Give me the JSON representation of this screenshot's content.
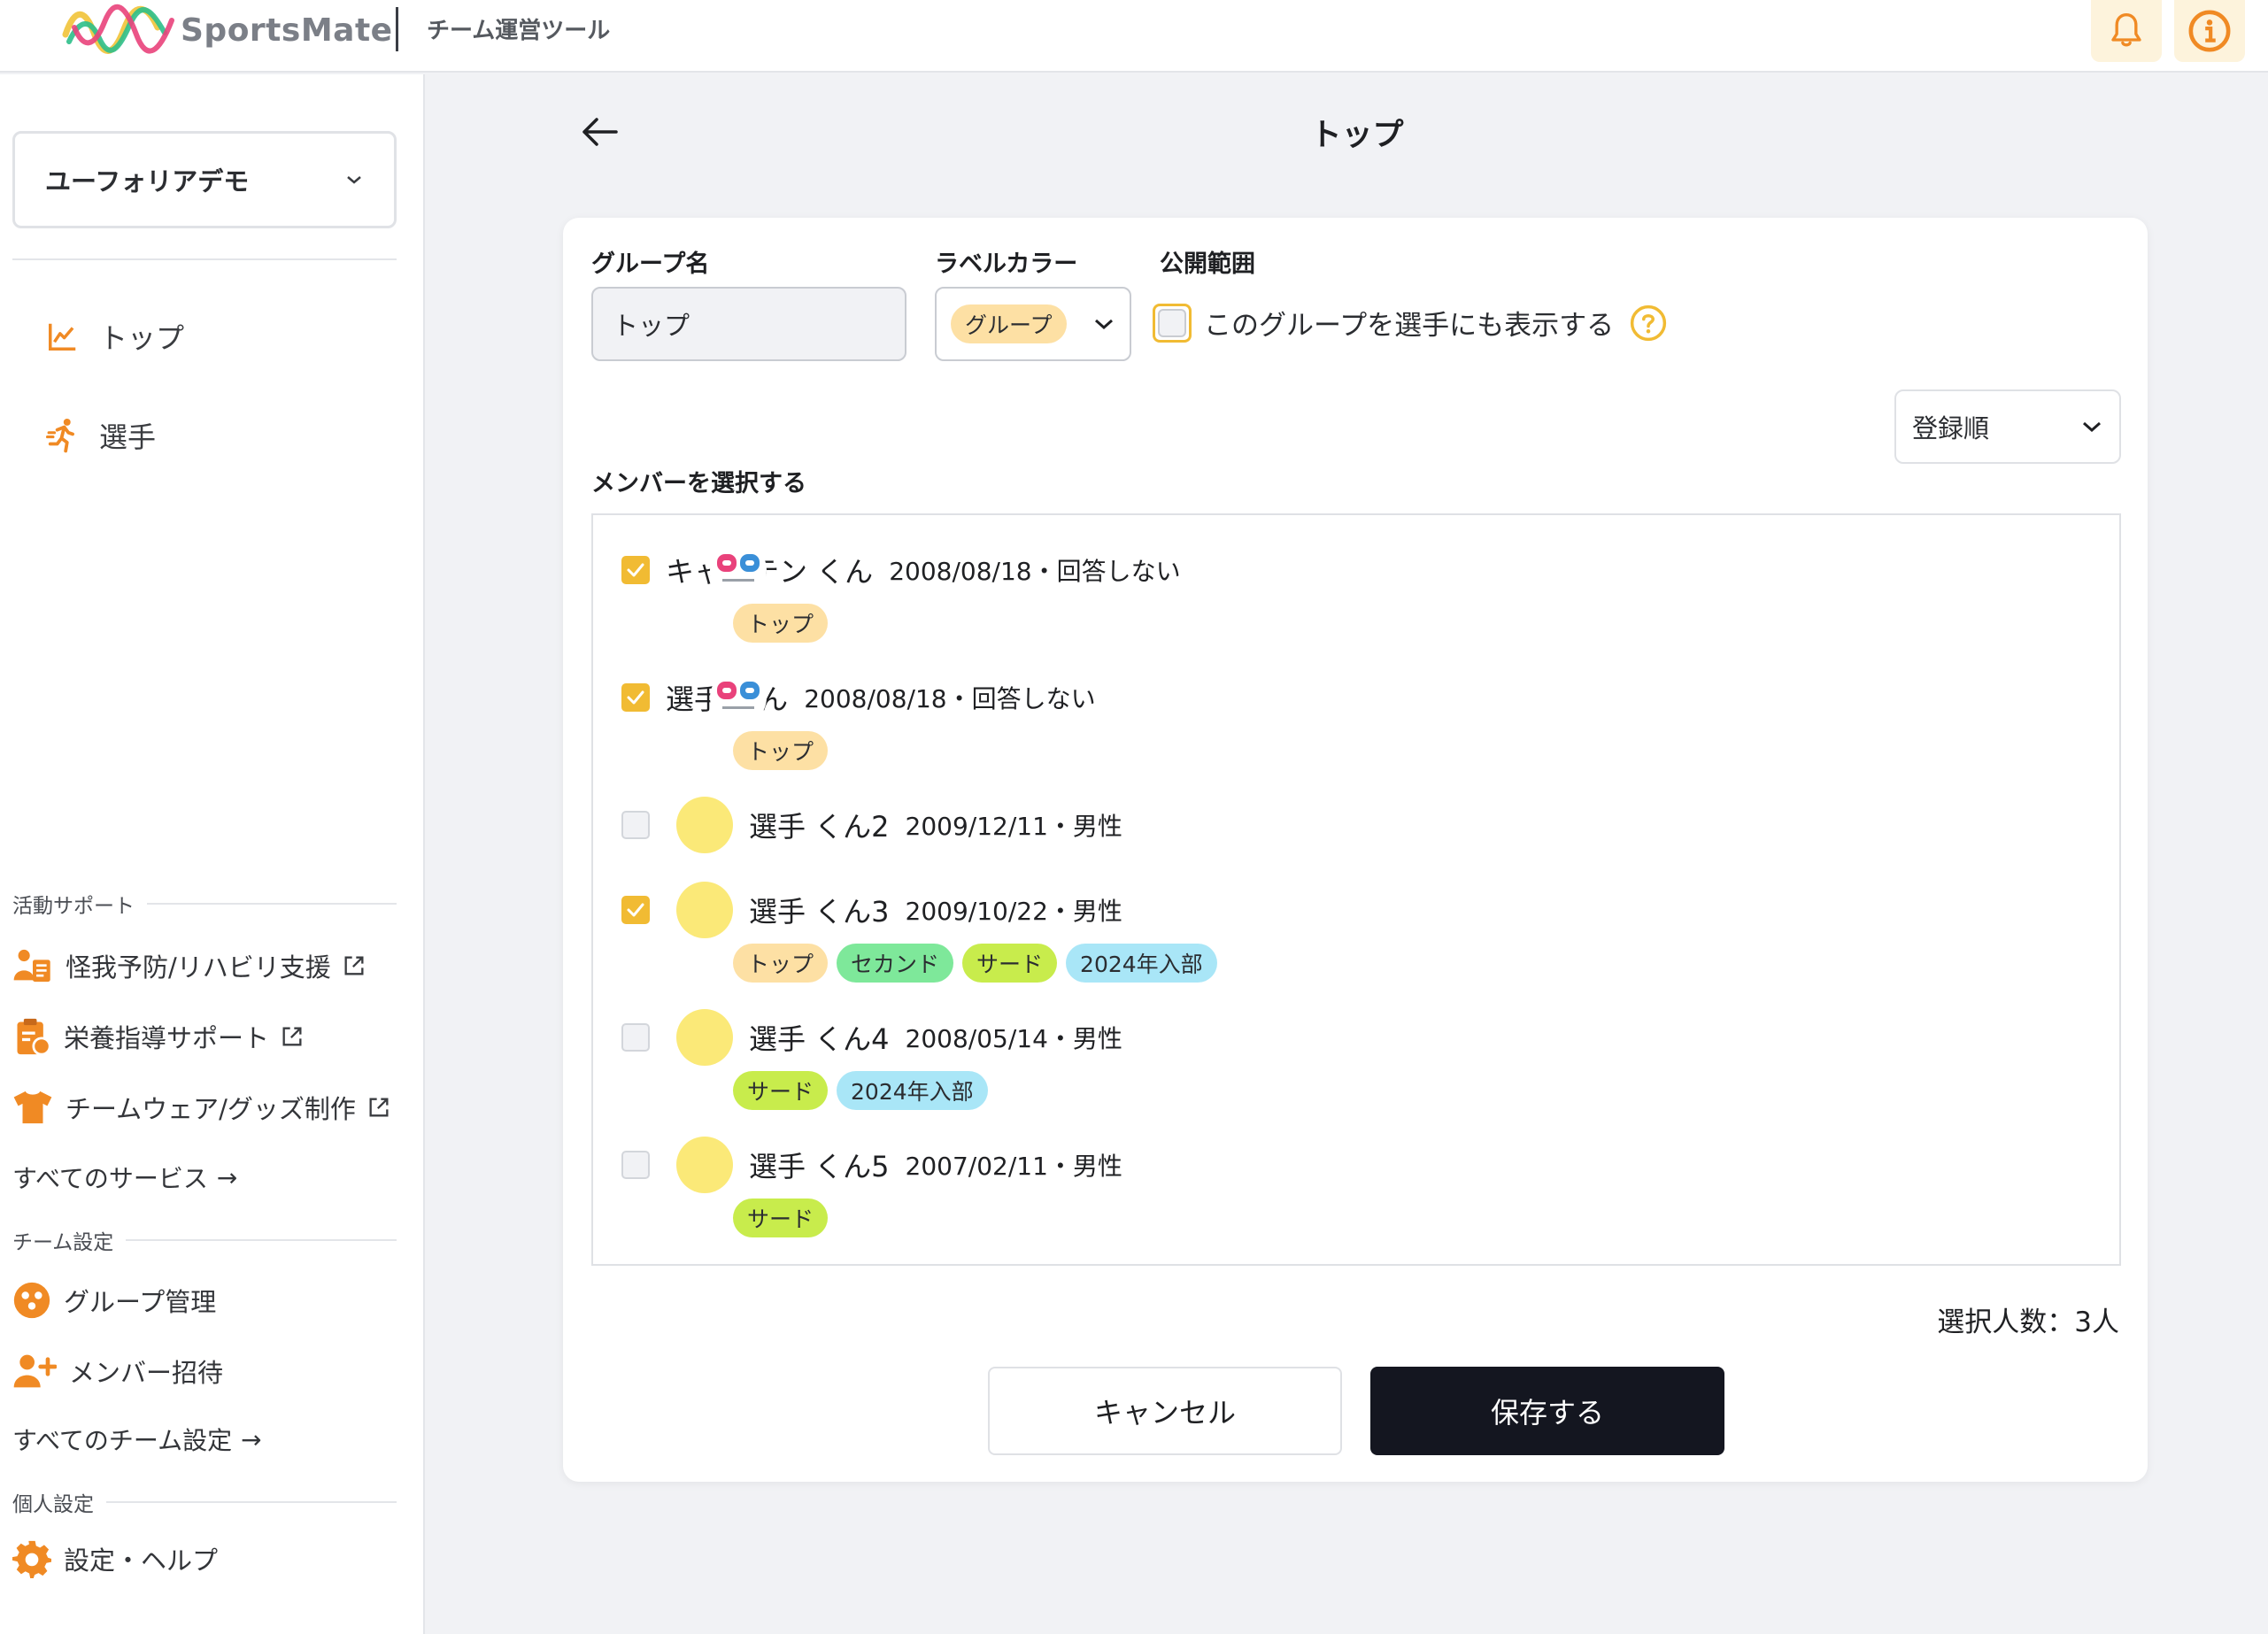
{
  "header": {
    "brand": "SportsMate",
    "subtitle": "チーム運営ツール",
    "bell_icon": "bell-icon",
    "info_icon": "info-icon"
  },
  "sidebar": {
    "team_name": "ユーフォリアデモ",
    "nav": [
      {
        "label": "トップ",
        "icon": "chart-line-icon"
      },
      {
        "label": "選手",
        "icon": "running-person-icon"
      }
    ],
    "sections": {
      "support_title": "活動サポート",
      "support_items": [
        {
          "label": "怪我予防/リハビリ支援",
          "icon": "person-clipboard-icon"
        },
        {
          "label": "栄養指導サポート",
          "icon": "clipboard-icon"
        },
        {
          "label": "チームウェア/グッズ制作",
          "icon": "tshirt-icon"
        }
      ],
      "all_services": "すべてのサービス",
      "team_title": "チーム設定",
      "team_items": [
        {
          "label": "グループ管理",
          "icon": "group-icon"
        },
        {
          "label": "メンバー招待",
          "icon": "person-add-icon"
        }
      ],
      "all_team_settings": "すべてのチーム設定",
      "personal_title": "個人設定",
      "personal_items": [
        {
          "label": "設定・ヘルプ",
          "icon": "gear-icon"
        }
      ]
    }
  },
  "main": {
    "title": "トップ",
    "form": {
      "group_name_label": "グループ名",
      "group_name_value": "トップ",
      "label_color_label": "ラベルカラー",
      "label_color_value": "グループ",
      "visibility_label": "公開範囲",
      "visibility_checkbox_label": "このグループを選手にも表示する",
      "members_label": "メンバーを選択する",
      "sort_value": "登録順"
    },
    "members": [
      {
        "name": "キャプテン くん",
        "meta": "2008/08/18・回答しない",
        "checked": true,
        "avatar": "logo",
        "tags": [
          {
            "label": "トップ",
            "color": "#fde0a4"
          }
        ]
      },
      {
        "name": "選手 くん",
        "meta": "2008/08/18・回答しない",
        "checked": true,
        "avatar": "logo",
        "tags": [
          {
            "label": "トップ",
            "color": "#fde0a4"
          }
        ]
      },
      {
        "name": "選手 くん2",
        "meta": "2009/12/11・男性",
        "checked": false,
        "avatar": "yellow",
        "tags": []
      },
      {
        "name": "選手 くん3",
        "meta": "2009/10/22・男性",
        "checked": true,
        "avatar": "yellow",
        "tags": [
          {
            "label": "トップ",
            "color": "#fde0a4"
          },
          {
            "label": "セカンド",
            "color": "#7ee89a"
          },
          {
            "label": "サード",
            "color": "#c8ec4c"
          },
          {
            "label": "2024年入部",
            "color": "#a9e6f7"
          }
        ]
      },
      {
        "name": "選手 くん4",
        "meta": "2008/05/14・男性",
        "checked": false,
        "avatar": "yellow",
        "tags": [
          {
            "label": "サード",
            "color": "#c8ec4c"
          },
          {
            "label": "2024年入部",
            "color": "#a9e6f7"
          }
        ]
      },
      {
        "name": "選手 くん5",
        "meta": "2007/02/11・男性",
        "checked": false,
        "avatar": "yellow",
        "tags": [
          {
            "label": "サード",
            "color": "#c8ec4c"
          }
        ]
      }
    ],
    "selected_count": "選択人数：3人",
    "cancel_label": "キャンセル",
    "save_label": "保存する"
  },
  "colors": {
    "accent": "#f1bb33",
    "icon_orange": "#f08a24",
    "dark_button": "#141620"
  }
}
